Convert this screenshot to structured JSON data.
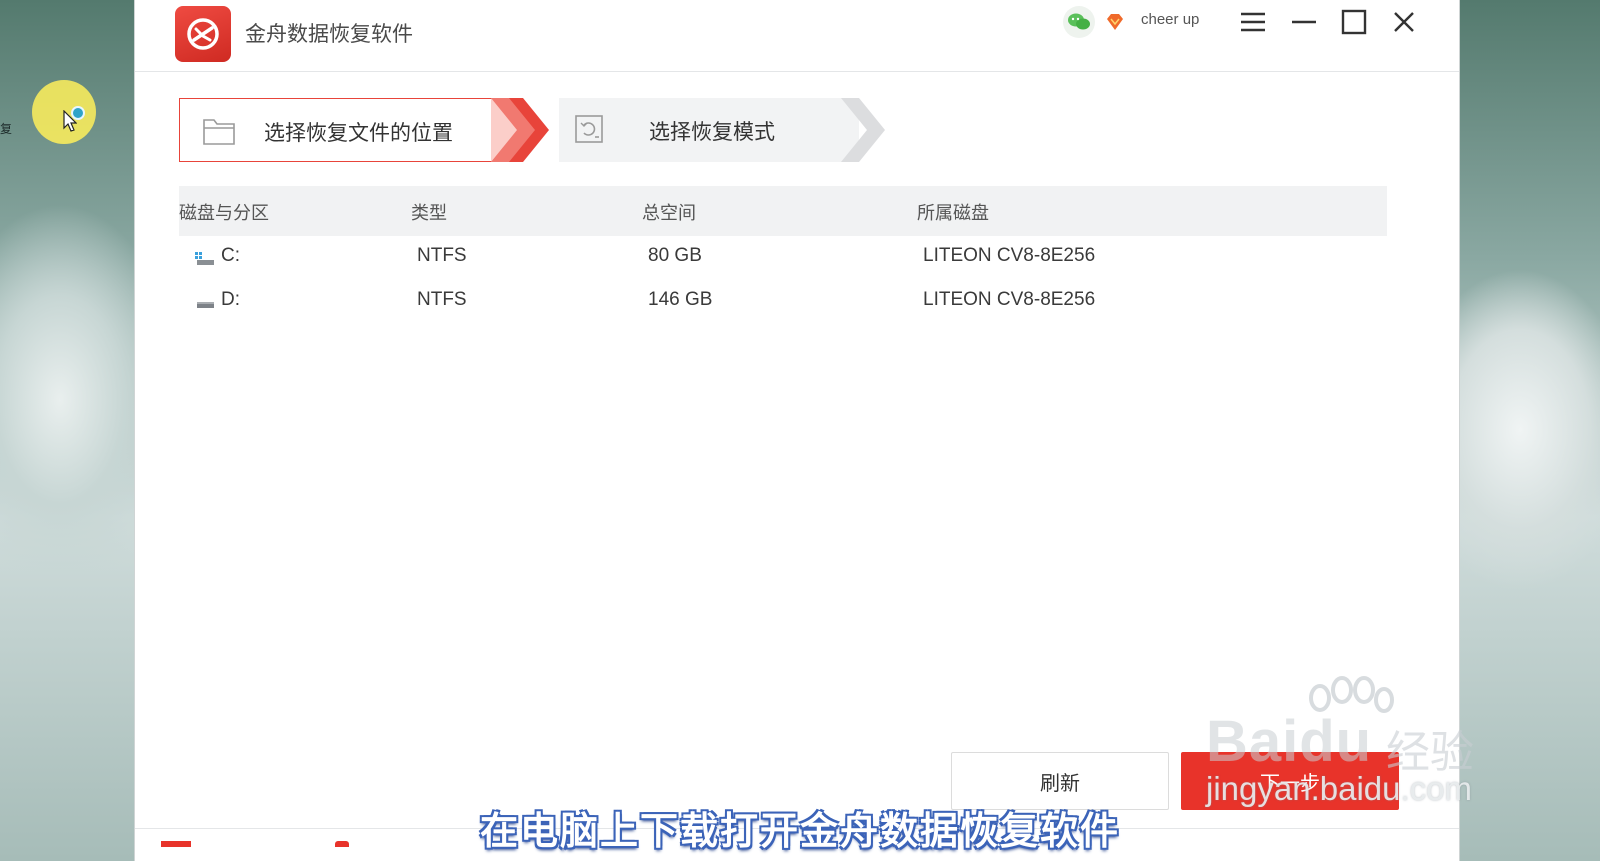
{
  "app": {
    "title": "金舟数据恢复软件",
    "username": "cheer up",
    "accent_color": "#e8332a"
  },
  "window_controls": {
    "icons": [
      "wechat-icon",
      "vip-diamond-icon",
      "menu-icon",
      "minimize-icon",
      "maximize-icon",
      "close-icon"
    ]
  },
  "steps": [
    {
      "label": "选择恢复文件的位置",
      "icon": "folder-icon",
      "active": true
    },
    {
      "label": "选择恢复模式",
      "icon": "restore-disk-icon",
      "active": false
    }
  ],
  "table": {
    "headers": [
      "磁盘与分区",
      "类型",
      "总空间",
      "所属磁盘"
    ],
    "rows": [
      {
        "partition": "C:",
        "type": "NTFS",
        "size": "80 GB",
        "disk": "LITEON CV8-8E256",
        "icon": "system-drive-icon"
      },
      {
        "partition": "D:",
        "type": "NTFS",
        "size": "146 GB",
        "disk": "LITEON CV8-8E256",
        "icon": "drive-icon"
      }
    ]
  },
  "buttons": {
    "refresh": "刷新",
    "next": "下一步"
  },
  "overlay": {
    "subtitle": "在电脑上下载打开金舟数据恢复软件",
    "watermark_brand": "Baidu",
    "watermark_cn": "经验",
    "watermark_url": "jingyan.baidu.com"
  },
  "desktop": {
    "edge_glyph": "复"
  }
}
